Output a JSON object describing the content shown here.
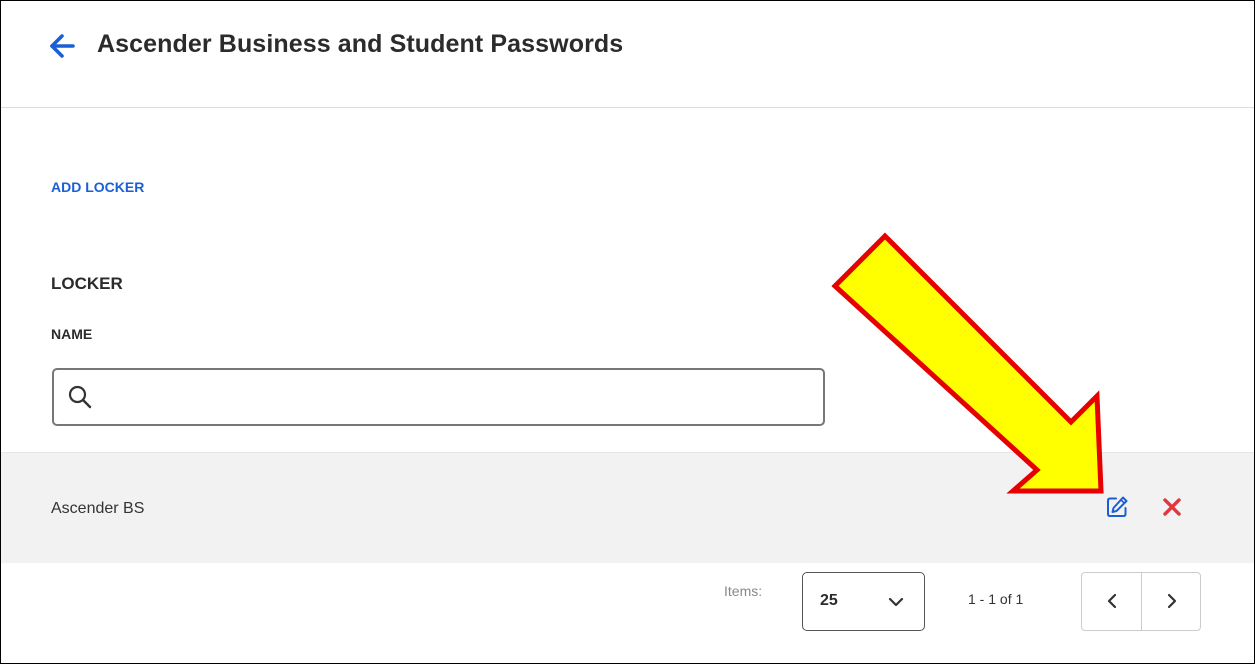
{
  "header": {
    "title": "Ascender Business and Student Passwords",
    "back_icon": "arrow-left-icon"
  },
  "actions": {
    "add_locker_label": "ADD LOCKER"
  },
  "table": {
    "section_heading": "LOCKER",
    "column_label": "NAME",
    "search": {
      "value": "",
      "placeholder": "",
      "icon": "search-icon"
    },
    "rows": [
      {
        "name": "Ascender BS",
        "actions": [
          "edit-icon",
          "delete-icon"
        ]
      }
    ]
  },
  "pagination": {
    "items_label": "Items:",
    "page_size": "25",
    "range_text": "1 - 1 of 1",
    "prev_icon": "chevron-left-icon",
    "next_icon": "chevron-right-icon"
  },
  "colors": {
    "accent_blue": "#1a5fd6",
    "delete_red": "#e0383e",
    "row_background": "#f2f2f2",
    "annotation_arrow_fill": "#ffff00",
    "annotation_arrow_stroke": "#e60000"
  }
}
